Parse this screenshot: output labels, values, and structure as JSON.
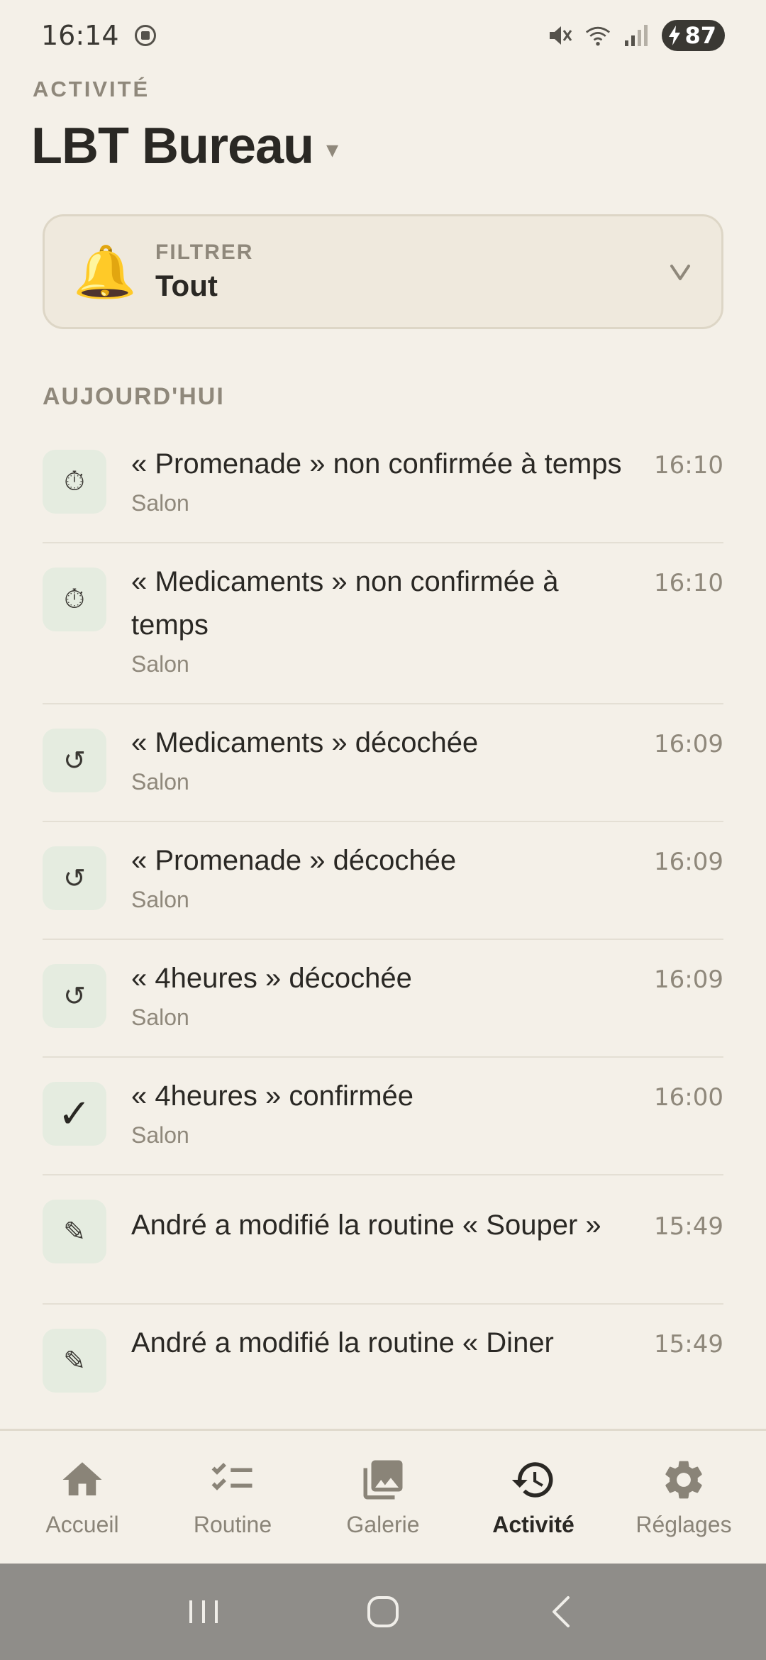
{
  "status_bar": {
    "time": "16:14",
    "battery": "87"
  },
  "header": {
    "eyebrow": "ACTIVITÉ",
    "title": "LBT Bureau",
    "caret": "▾"
  },
  "filter": {
    "label": "FILTRER",
    "value": "Tout",
    "icon": "bell-icon"
  },
  "section_label": "AUJOURD'HUI",
  "activities": [
    {
      "icon": "timer-icon",
      "glyph": "⏱",
      "title": "« Promenade » non confirmée à temps",
      "subtitle": "Salon",
      "time": "16:10"
    },
    {
      "icon": "timer-icon",
      "glyph": "⏱",
      "title": "« Medicaments » non confirmée à temps",
      "subtitle": "Salon",
      "time": "16:10"
    },
    {
      "icon": "undo-icon",
      "glyph": "↺",
      "title": "« Medicaments » décochée",
      "subtitle": "Salon",
      "time": "16:09"
    },
    {
      "icon": "undo-icon",
      "glyph": "↺",
      "title": "« Promenade » décochée",
      "subtitle": "Salon",
      "time": "16:09"
    },
    {
      "icon": "undo-icon",
      "glyph": "↺",
      "title": "« 4heures » décochée",
      "subtitle": "Salon",
      "time": "16:09"
    },
    {
      "icon": "check-icon",
      "glyph": "✓",
      "title": "« 4heures » confirmée",
      "subtitle": "Salon",
      "time": "16:00"
    },
    {
      "icon": "pencil-icon",
      "glyph": "✎",
      "title": "André a modifié la routine « Souper »",
      "subtitle": "",
      "time": "15:49"
    },
    {
      "icon": "pencil-icon",
      "glyph": "✎",
      "title": "André a modifié la routine « Diner",
      "subtitle": "",
      "time": "15:49"
    }
  ],
  "nav": {
    "items": [
      {
        "label": "Accueil",
        "icon": "home-icon"
      },
      {
        "label": "Routine",
        "icon": "checklist-icon"
      },
      {
        "label": "Galerie",
        "icon": "gallery-icon"
      },
      {
        "label": "Activité",
        "icon": "history-icon",
        "active": true
      },
      {
        "label": "Réglages",
        "icon": "gear-icon"
      }
    ]
  },
  "colors": {
    "background": "#f4f0e8",
    "text": "#2a2824",
    "muted": "#8f887b",
    "icon_tile": "#e5ece0",
    "system_bar": "#8f8d89"
  }
}
